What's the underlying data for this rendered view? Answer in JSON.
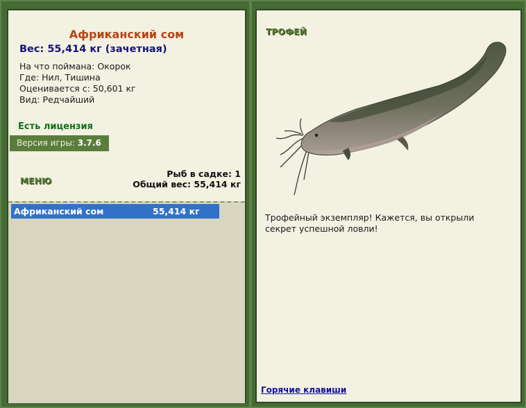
{
  "fish": {
    "name": "Африканский сом",
    "weight_line": "Вес: 55,414 кг (зачетная)",
    "bait": "На что поймана: Окорок",
    "location": "Где: Нил, Тишина",
    "min_weight": "Оценивается с: 50,601 кг",
    "rarity": "Вид: Редчайший"
  },
  "license": "Есть лицензия",
  "version": {
    "label": "Версия игры:",
    "value": "3.7.6"
  },
  "menu_label": "МЕНЮ",
  "stats": {
    "count": "Рыб в садке: 1",
    "total": "Общий вес: 55,414 кг"
  },
  "keepnet": [
    {
      "name": "Африканский сом",
      "weight": "55,414 кг"
    }
  ],
  "trophy_label": "ТРОФЕЙ",
  "trophy_text": "Трофейный экземпляр! Кажется, вы открыли секрет успешной ловли!",
  "hotkeys_link": "Горячие клавиши",
  "icons": {
    "fish_image": "catfish-image"
  }
}
